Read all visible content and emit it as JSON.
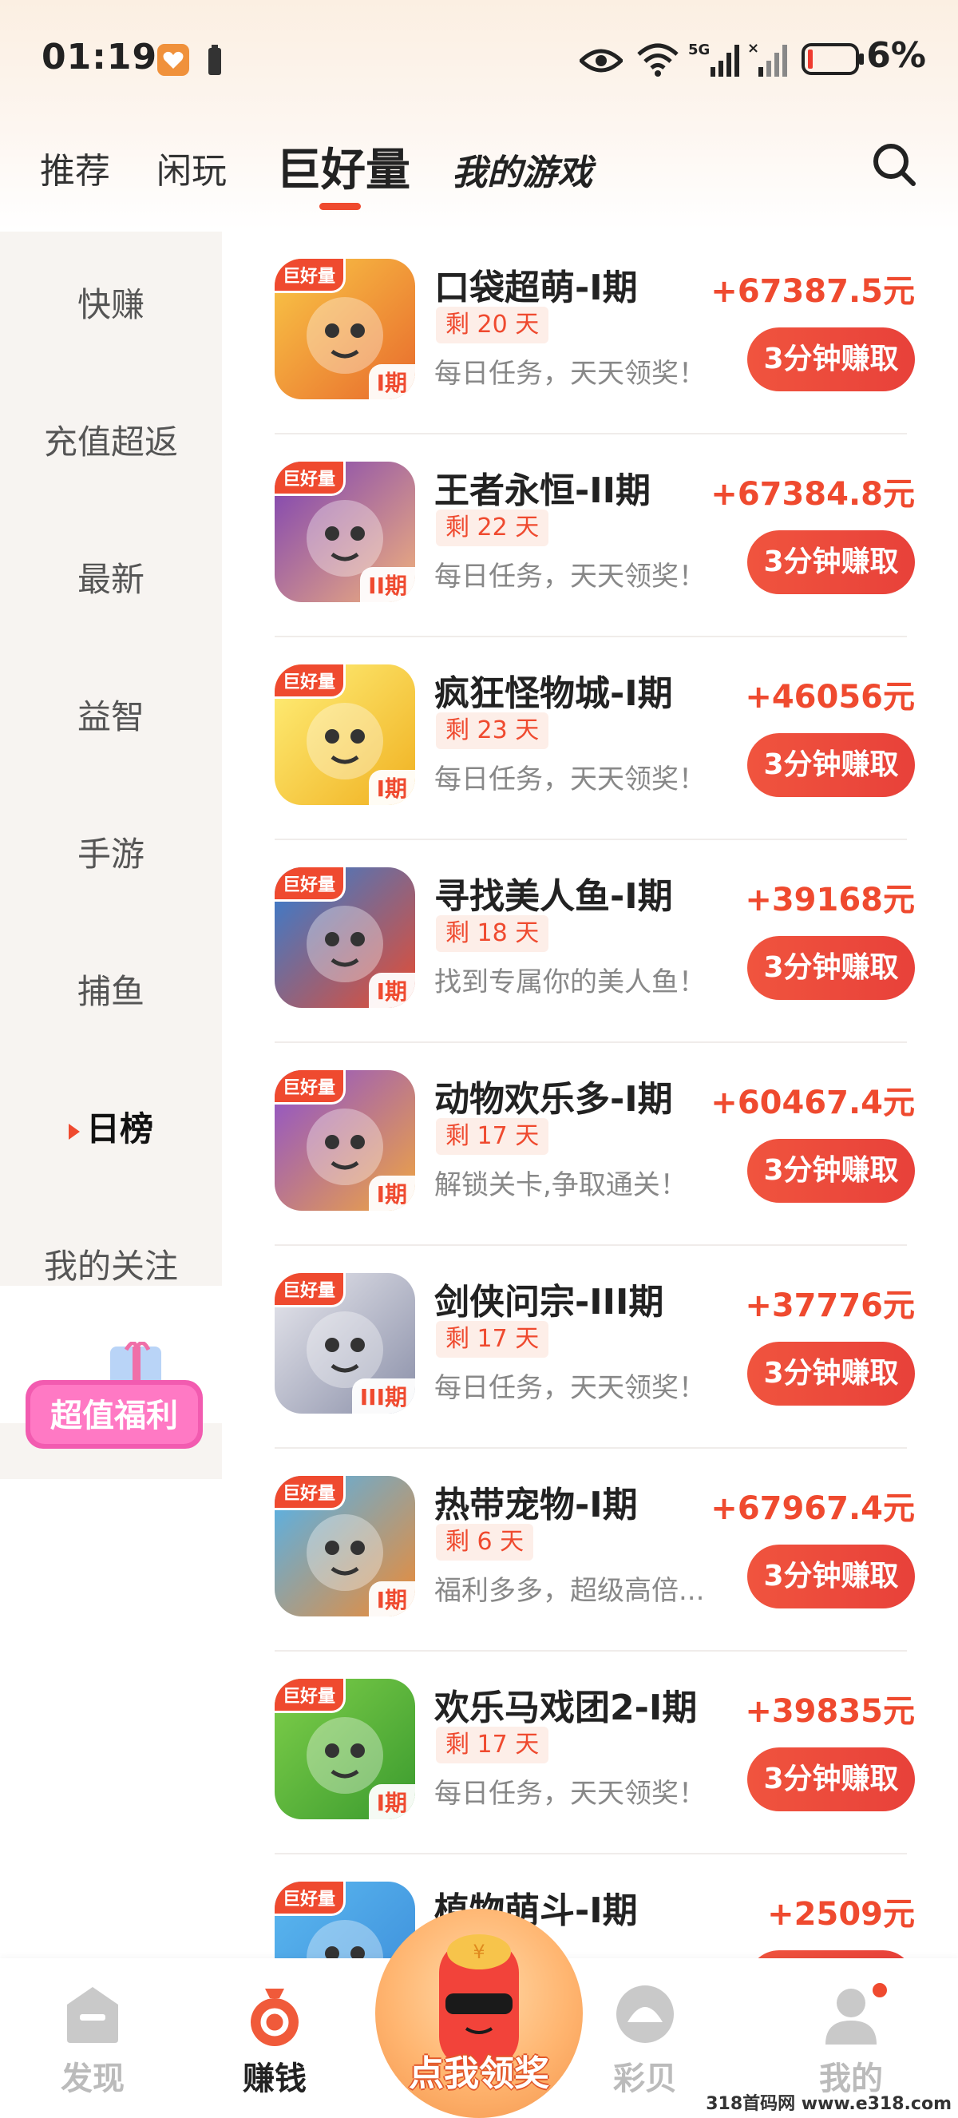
{
  "status_bar": {
    "time": "01:19",
    "network": "5G",
    "battery": "6%"
  },
  "top_tabs": [
    {
      "label": "推荐"
    },
    {
      "label": "闲玩"
    },
    {
      "label": "巨好量"
    },
    {
      "label": "我的游戏"
    }
  ],
  "sidebar": {
    "items": [
      {
        "label": "快赚"
      },
      {
        "label": "充值超返"
      },
      {
        "label": "最新"
      },
      {
        "label": "益智"
      },
      {
        "label": "手游"
      },
      {
        "label": "捕鱼"
      },
      {
        "label": "日榜"
      },
      {
        "label": "我的关注"
      }
    ],
    "promo_label": "超值福利"
  },
  "badge_label": "巨好量",
  "button_label": "3分钟赚取",
  "games": [
    {
      "title": "口袋超萌-I期",
      "days": "剩 20 天",
      "desc": "每日任务，天天领奖！",
      "amount": "+67387.5元",
      "period": "I期",
      "c1": "#f9c847",
      "c2": "#e86a2c"
    },
    {
      "title": "王者永恒-II期",
      "days": "剩 22 天",
      "desc": "每日任务，天天领奖！",
      "amount": "+67384.8元",
      "period": "II期",
      "c1": "#7a3fb5",
      "c2": "#f2b27c"
    },
    {
      "title": "疯狂怪物城-I期",
      "days": "剩 23 天",
      "desc": "每日任务，天天领奖！",
      "amount": "+46056元",
      "period": "I期",
      "c1": "#fff07a",
      "c2": "#f0b020"
    },
    {
      "title": "寻找美人鱼-I期",
      "days": "剩 18 天",
      "desc": "找到专属你的美人鱼！",
      "amount": "+39168元",
      "period": "I期",
      "c1": "#2c7fd8",
      "c2": "#e94b2f"
    },
    {
      "title": "动物欢乐多-I期",
      "days": "剩 17 天",
      "desc": "解锁关卡,争取通关！",
      "amount": "+60467.4元",
      "period": "I期",
      "c1": "#8b4fd0",
      "c2": "#f1a640"
    },
    {
      "title": "剑侠问宗-III期",
      "days": "剩 17 天",
      "desc": "每日任务，天天领奖！",
      "amount": "+37776元",
      "period": "III期",
      "c1": "#e8e8ee",
      "c2": "#8a8fa8"
    },
    {
      "title": "热带宠物-I期",
      "days": "剩 6 天",
      "desc": "福利多多，超级高倍...",
      "amount": "+67967.4元",
      "period": "I期",
      "c1": "#4cb4f4",
      "c2": "#f08a32"
    },
    {
      "title": "欢乐马戏团2-I期",
      "days": "剩 17 天",
      "desc": "每日任务，天天领奖！",
      "amount": "+39835元",
      "period": "I期",
      "c1": "#7fcf4a",
      "c2": "#3a9a2e"
    },
    {
      "title": "植物萌斗-I期",
      "days": "",
      "desc": "",
      "amount": "+2509元",
      "period": "",
      "c1": "#5bb8f0",
      "c2": "#3a8ad8"
    }
  ],
  "bottom_nav": [
    {
      "label": "发现"
    },
    {
      "label": "赚钱"
    },
    {
      "label": "点我领奖"
    },
    {
      "label": "彩贝"
    },
    {
      "label": "我的"
    }
  ],
  "watermark": "318首码网 www.e318.com",
  "colors": {
    "accent": "#ef4a2f",
    "sidebar_bg": "#f7f4f1"
  }
}
